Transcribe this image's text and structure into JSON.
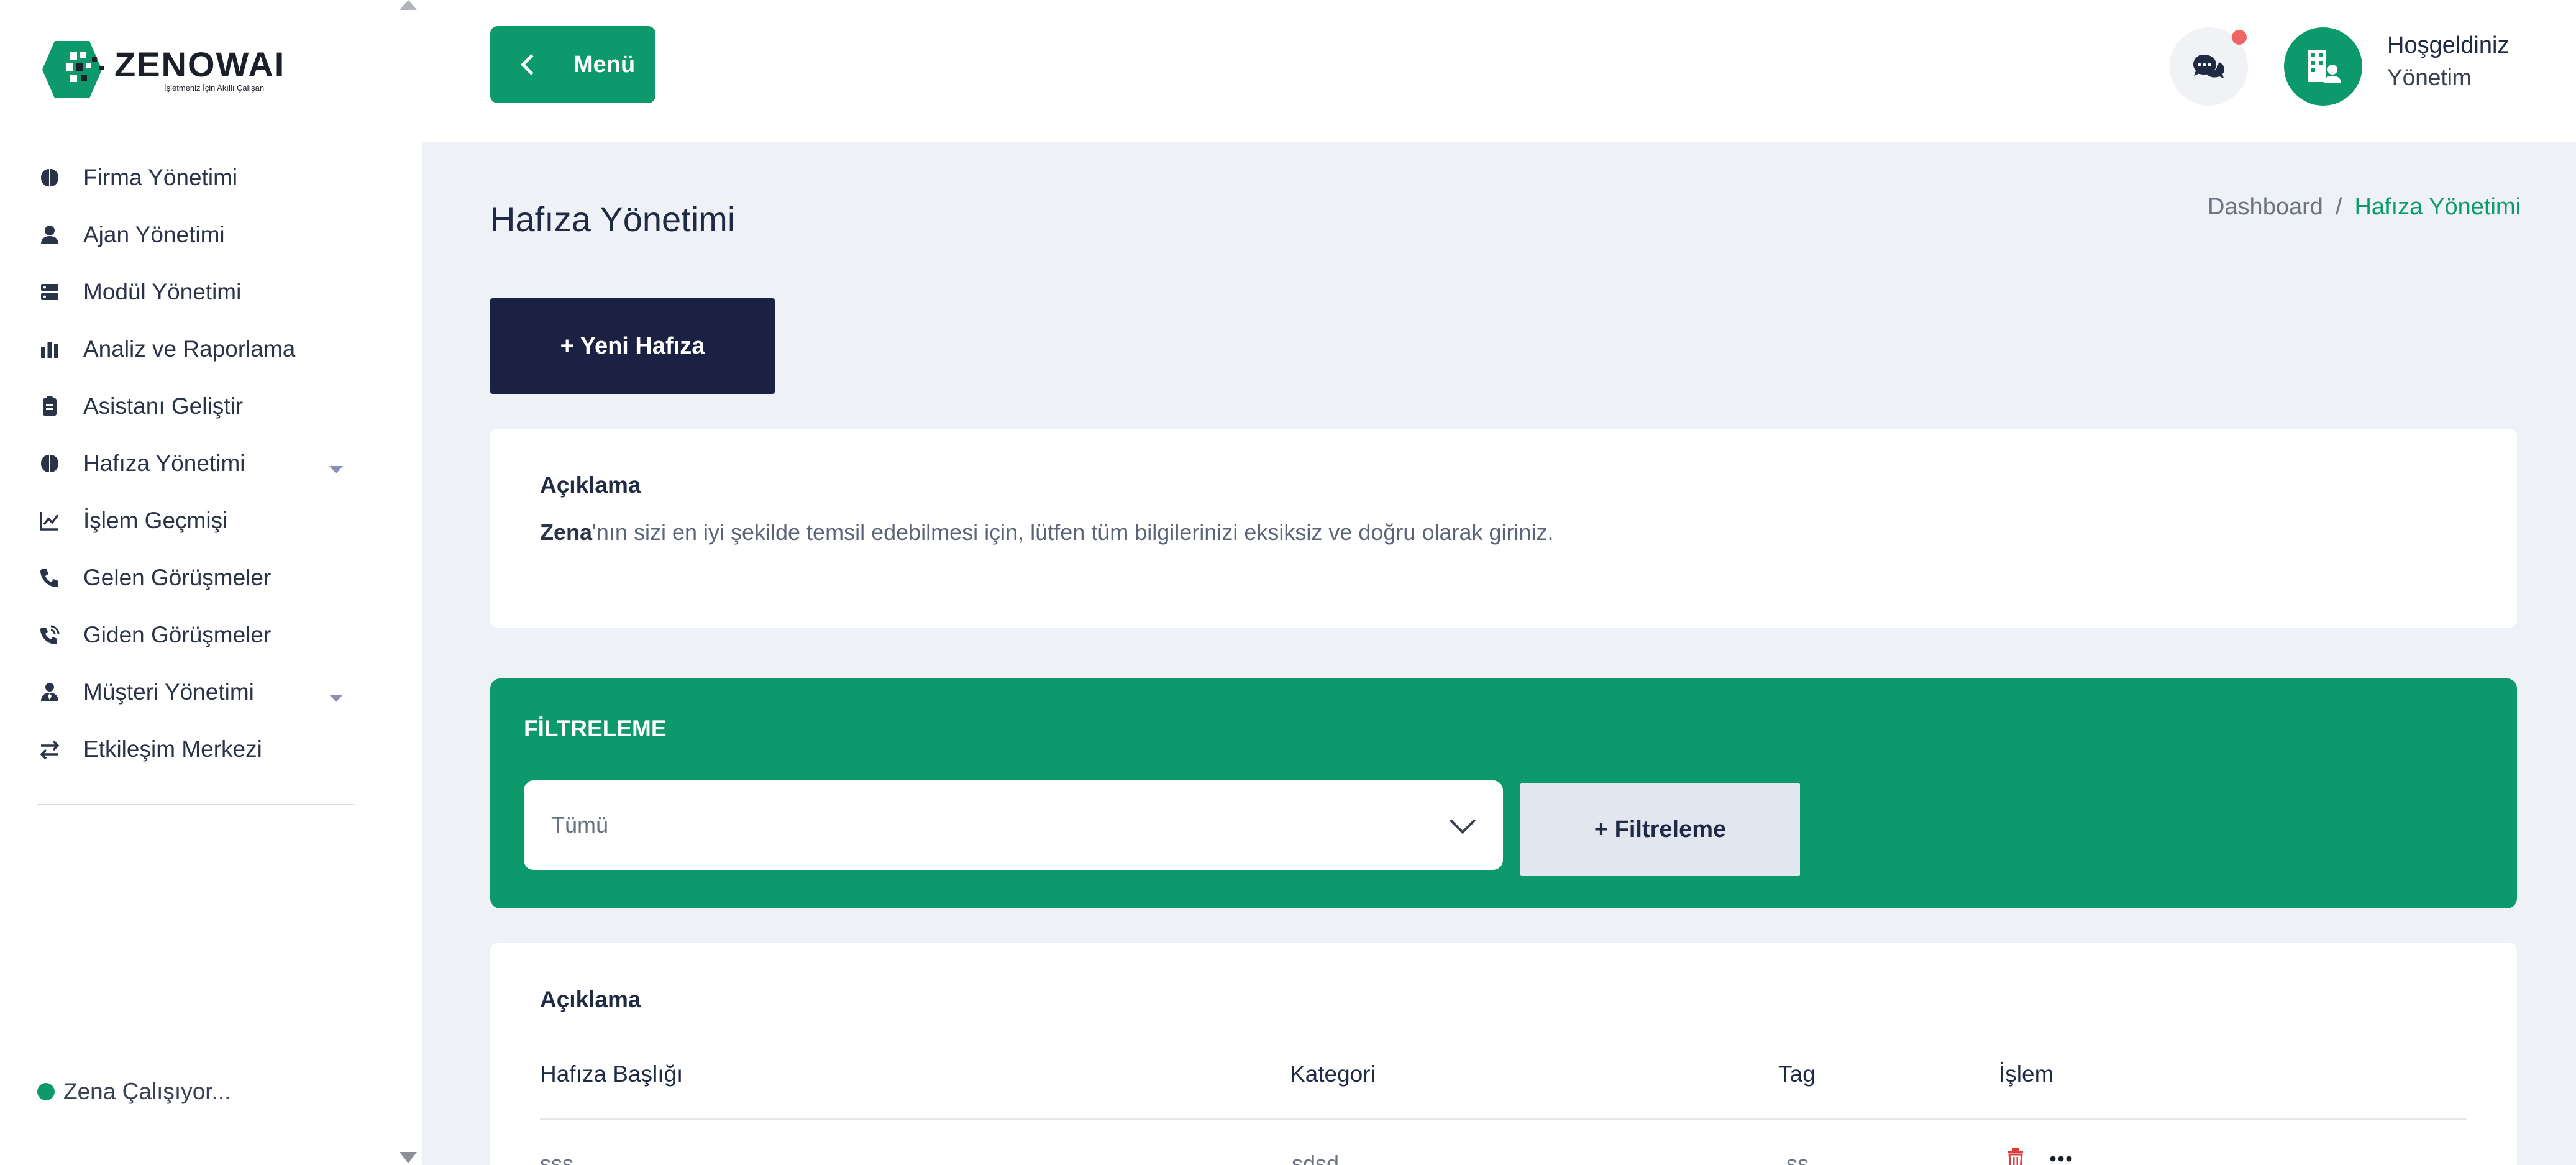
{
  "brand": {
    "name": "ZENOWAI",
    "tagline": "İşletmeniz İçin Akıllı Çalışan"
  },
  "sidebar": {
    "items": [
      {
        "label": "Firma Yönetimi",
        "icon": "brain-icon",
        "has_submenu": false
      },
      {
        "label": "Ajan Yönetimi",
        "icon": "user-icon",
        "has_submenu": false
      },
      {
        "label": "Modül Yönetimi",
        "icon": "server-icon",
        "has_submenu": false
      },
      {
        "label": "Analiz ve Raporlama",
        "icon": "bar-chart-icon",
        "has_submenu": false
      },
      {
        "label": "Asistanı Geliştir",
        "icon": "clipboard-icon",
        "has_submenu": false
      },
      {
        "label": "Hafıza Yönetimi",
        "icon": "brain-icon",
        "has_submenu": true
      },
      {
        "label": "İşlem Geçmişi",
        "icon": "line-chart-icon",
        "has_submenu": false
      },
      {
        "label": "Gelen Görüşmeler",
        "icon": "phone-icon",
        "has_submenu": false
      },
      {
        "label": "Giden Görüşmeler",
        "icon": "phone-outgoing-icon",
        "has_submenu": false
      },
      {
        "label": "Müşteri Yönetimi",
        "icon": "user-tie-icon",
        "has_submenu": true
      },
      {
        "label": "Etkileşim Merkezi",
        "icon": "swap-icon",
        "has_submenu": false
      }
    ],
    "status": "Zena Çalışıyor..."
  },
  "header": {
    "menu_label": "Menü",
    "welcome": "Hoşgeldiniz",
    "role": "Yönetim"
  },
  "page": {
    "title": "Hafıza Yönetimi",
    "breadcrumb": {
      "home": "Dashboard",
      "separator": "/",
      "current": "Hafıza Yönetimi"
    },
    "new_button": "+ Yeni Hafıza"
  },
  "description_card": {
    "title": "Açıklama",
    "text_bold": "Zena",
    "text_rest": "'nın sizi en iyi şekilde temsil edebilmesi için, lütfen tüm bilgilerinizi eksiksiz ve doğru olarak giriniz."
  },
  "filter": {
    "title": "FİLTRELEME",
    "select_value": "Tümü",
    "button": "+ Filtreleme"
  },
  "table_card": {
    "title": "Açıklama",
    "columns": [
      "Hafıza Başlığı",
      "Kategori",
      "Tag",
      "İşlem"
    ],
    "rows": [
      {
        "title": "sss",
        "category": "sdsd",
        "tag": "ss"
      }
    ]
  },
  "colors": {
    "primary": "#0c9a6d",
    "navy": "#1b2142",
    "background": "#eef2f6",
    "danger": "#e03b3b"
  }
}
